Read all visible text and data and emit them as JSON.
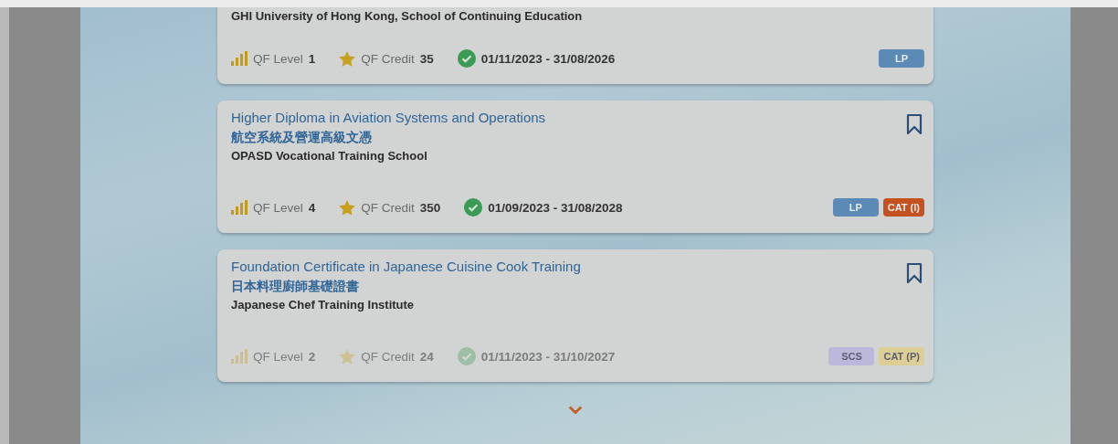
{
  "courses": [
    {
      "provider": "GHI University of Hong Kong, School of Continuing Education",
      "qf_level_label": "QF Level",
      "qf_level": "1",
      "credit_label": "QF Credit",
      "credit": "35",
      "dates": "01/11/2023 - 31/08/2026",
      "faded": false,
      "badges": [
        {
          "text": "LP",
          "color": "#5a8ab5"
        }
      ]
    },
    {
      "title": "Higher Diploma in Aviation Systems and Operations",
      "title_zh": "航空系統及營運高級文憑",
      "provider": "OPASD Vocational Training School",
      "bookmark": true,
      "qf_level_label": "QF Level",
      "qf_level": "4",
      "credit_label": "QF Credit",
      "credit": "350",
      "dates": "01/09/2023 - 31/08/2028",
      "faded": false,
      "badges": [
        {
          "text": "LP",
          "color": "#5a8ab5"
        },
        {
          "text": "CAT (I)",
          "color": "#c4521f"
        }
      ]
    },
    {
      "title": "Foundation Certificate in Japanese Cuisine Cook Training",
      "title_zh": "日本料理廚師基礎證書",
      "provider": "Japanese Chef Training Institute",
      "bookmark": true,
      "qf_level_label": "QF Level",
      "qf_level": "2",
      "credit_label": "QF Credit",
      "credit": "24",
      "dates": "01/11/2023 - 31/10/2027",
      "faded": true,
      "badges": [
        {
          "text": "SCS",
          "color": "#bcb8dc"
        },
        {
          "text": "CAT (P)",
          "color": "#dccf96"
        }
      ]
    }
  ],
  "more_button": "⌄"
}
